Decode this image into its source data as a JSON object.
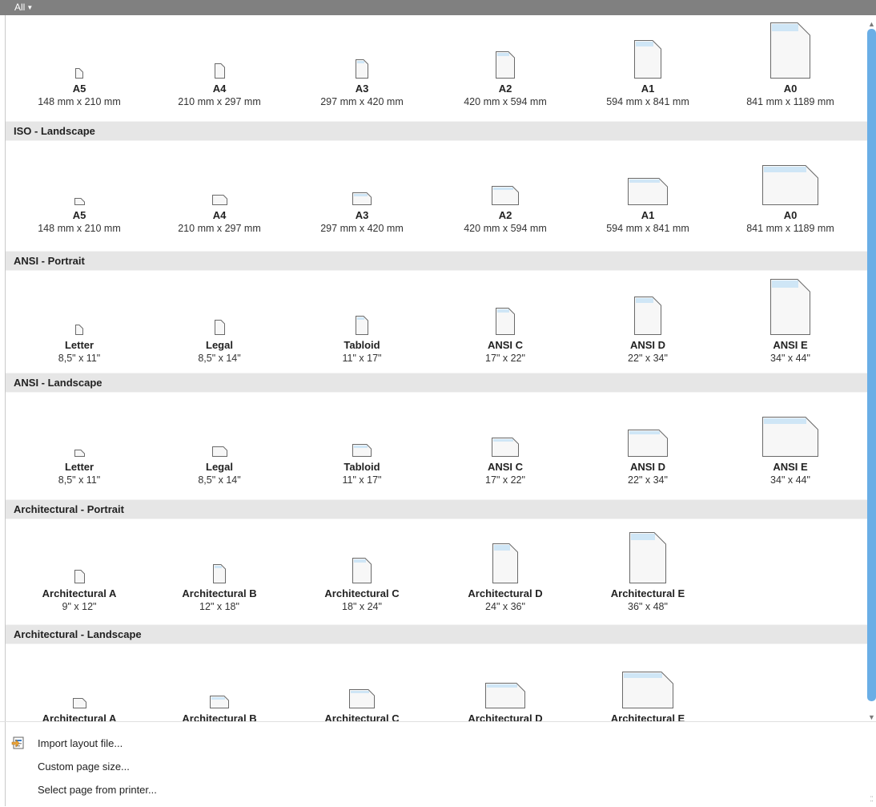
{
  "filter": {
    "label": "All"
  },
  "sections": [
    {
      "title": "",
      "orientation": "portrait",
      "items": [
        {
          "name": "A5",
          "size": "148 mm x 210 mm"
        },
        {
          "name": "A4",
          "size": "210 mm x 297 mm"
        },
        {
          "name": "A3",
          "size": "297 mm x 420 mm"
        },
        {
          "name": "A2",
          "size": "420 mm x 594 mm"
        },
        {
          "name": "A1",
          "size": "594 mm x 841 mm"
        },
        {
          "name": "A0",
          "size": "841 mm x 1189 mm"
        }
      ]
    },
    {
      "title": "ISO - Landscape",
      "orientation": "landscape",
      "items": [
        {
          "name": "A5",
          "size": "148 mm x 210 mm"
        },
        {
          "name": "A4",
          "size": "210 mm x 297 mm"
        },
        {
          "name": "A3",
          "size": "297 mm x 420 mm"
        },
        {
          "name": "A2",
          "size": "420 mm x 594 mm"
        },
        {
          "name": "A1",
          "size": "594 mm x 841 mm"
        },
        {
          "name": "A0",
          "size": "841 mm x 1189 mm"
        }
      ]
    },
    {
      "title": "ANSI - Portrait",
      "orientation": "portrait",
      "items": [
        {
          "name": "Letter",
          "size": "8,5\" x 11\""
        },
        {
          "name": "Legal",
          "size": "8,5\" x 14\""
        },
        {
          "name": "Tabloid",
          "size": "11\" x 17\""
        },
        {
          "name": "ANSI C",
          "size": "17\" x 22\""
        },
        {
          "name": "ANSI D",
          "size": "22\" x 34\""
        },
        {
          "name": "ANSI E",
          "size": "34\" x 44\""
        }
      ]
    },
    {
      "title": "ANSI - Landscape",
      "orientation": "landscape",
      "items": [
        {
          "name": "Letter",
          "size": "8,5\" x 11\""
        },
        {
          "name": "Legal",
          "size": "8,5\" x 14\""
        },
        {
          "name": "Tabloid",
          "size": "11\" x 17\""
        },
        {
          "name": "ANSI C",
          "size": "17\" x 22\""
        },
        {
          "name": "ANSI D",
          "size": "22\" x 34\""
        },
        {
          "name": "ANSI E",
          "size": "34\" x 44\""
        }
      ]
    },
    {
      "title": "Architectural - Portrait",
      "orientation": "portrait",
      "items": [
        {
          "name": "Architectural A",
          "size": "9\" x 12\""
        },
        {
          "name": "Architectural B",
          "size": "12\" x 18\""
        },
        {
          "name": "Architectural C",
          "size": "18\" x 24\""
        },
        {
          "name": "Architectural D",
          "size": "24\" x 36\""
        },
        {
          "name": "Architectural E",
          "size": "36\" x 48\""
        }
      ]
    },
    {
      "title": "Architectural - Landscape",
      "orientation": "landscape",
      "items": [
        {
          "name": "Architectural A",
          "size": ""
        },
        {
          "name": "Architectural B",
          "size": ""
        },
        {
          "name": "Architectural C",
          "size": ""
        },
        {
          "name": "Architectural D",
          "size": ""
        },
        {
          "name": "Architectural E",
          "size": ""
        }
      ]
    }
  ],
  "footer": {
    "import": "Import layout file...",
    "custom": "Custom page size...",
    "printer": "Select page from printer..."
  }
}
